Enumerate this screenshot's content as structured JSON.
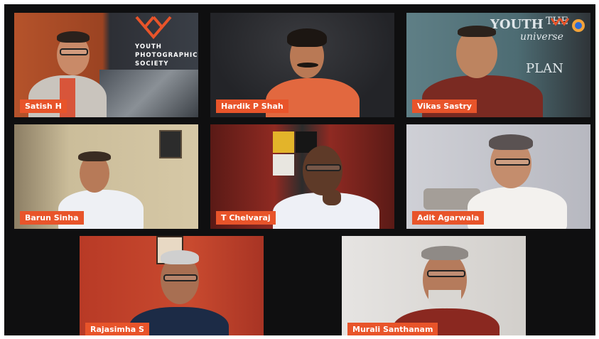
{
  "meeting": {
    "participants": [
      {
        "name": "Satish H"
      },
      {
        "name": "Hardik P Shah"
      },
      {
        "name": "Vikas Sastry"
      },
      {
        "name": "Barun Sinha"
      },
      {
        "name": "T Chelvaraj"
      },
      {
        "name": "Adit Agarwala"
      },
      {
        "name": "Rajasimha S"
      },
      {
        "name": "Murali Santhanam"
      }
    ]
  },
  "backdrop": {
    "satish_logo_lines": [
      "YOUTH",
      "PHOTOGRAPHIC",
      "SOCIETY"
    ],
    "vikas_board_words": [
      "YOUTH",
      "THE",
      "universe",
      "PLAN"
    ]
  },
  "colors": {
    "name_tag": "#e8542a",
    "grid_background": "#0f0f10",
    "brand_orange": "#e8542a"
  }
}
